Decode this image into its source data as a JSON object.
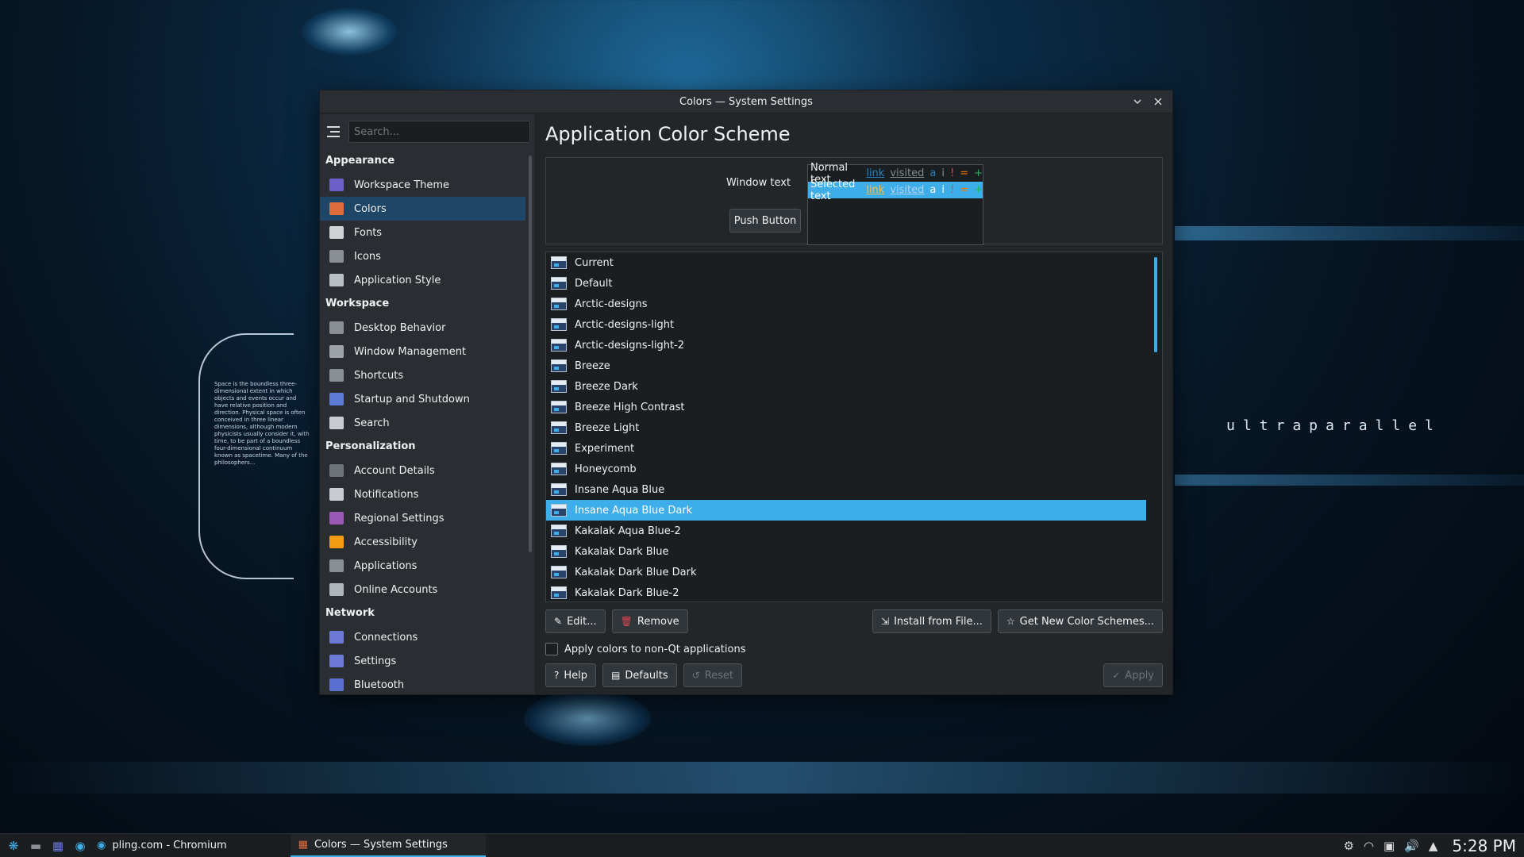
{
  "window": {
    "title": "Colors — System Settings"
  },
  "sidebar": {
    "search_placeholder": "Search...",
    "sections": [
      {
        "title": "Appearance",
        "items": [
          {
            "label": "Workspace Theme",
            "color": "#6c5fc7"
          },
          {
            "label": "Colors",
            "color": "#e06c3c",
            "active": true
          },
          {
            "label": "Fonts",
            "color": "#cfd3d6"
          },
          {
            "label": "Icons",
            "color": "#8a8f94"
          },
          {
            "label": "Application Style",
            "color": "#b9bec3"
          }
        ]
      },
      {
        "title": "Workspace",
        "items": [
          {
            "label": "Desktop Behavior",
            "color": "#8a8f94"
          },
          {
            "label": "Window Management",
            "color": "#9ea3a8"
          },
          {
            "label": "Shortcuts",
            "color": "#8a8f94"
          },
          {
            "label": "Startup and Shutdown",
            "color": "#5c7bd6"
          },
          {
            "label": "Search",
            "color": "#c9cdd1"
          }
        ]
      },
      {
        "title": "Personalization",
        "items": [
          {
            "label": "Account Details",
            "color": "#6e7378"
          },
          {
            "label": "Notifications",
            "color": "#c9cdd1"
          },
          {
            "label": "Regional Settings",
            "color": "#9b59b6"
          },
          {
            "label": "Accessibility",
            "color": "#f39c12"
          },
          {
            "label": "Applications",
            "color": "#8a8f94"
          },
          {
            "label": "Online Accounts",
            "color": "#b0b5ba"
          }
        ]
      },
      {
        "title": "Network",
        "items": [
          {
            "label": "Connections",
            "color": "#6c7ad6"
          },
          {
            "label": "Settings",
            "color": "#6c7ad6"
          },
          {
            "label": "Bluetooth",
            "color": "#5a6fd0"
          }
        ]
      }
    ]
  },
  "main": {
    "title": "Application Color Scheme",
    "preview": {
      "window_text_label": "Window text",
      "push_button_label": "Push Button",
      "normal": {
        "text": "Normal text",
        "link": "link",
        "visited": "visited",
        "a": "a",
        "i": "i",
        "neg": "!",
        "neu": "=",
        "pos": "+"
      },
      "selected": {
        "text": "Selected text",
        "link": "link",
        "visited": "visited",
        "a": "a",
        "i": "i",
        "neg": "!",
        "neu": "=",
        "pos": "+"
      }
    },
    "schemes": [
      "Current",
      "Default",
      "Arctic-designs",
      "Arctic-designs-light",
      "Arctic-designs-light-2",
      "Breeze",
      "Breeze Dark",
      "Breeze High Contrast",
      "Breeze Light",
      "Experiment",
      "Honeycomb",
      "Insane Aqua Blue",
      "Insane Aqua Blue Dark",
      "Kakalak Aqua Blue-2",
      "Kakalak Dark Blue",
      "Kakalak Dark Blue Dark",
      "Kakalak Dark Blue-2"
    ],
    "selected_scheme": "Insane Aqua Blue Dark",
    "buttons": {
      "edit": "Edit...",
      "remove": "Remove",
      "install": "Install from File...",
      "get_new": "Get New Color Schemes..."
    },
    "checkbox_label": "Apply colors to non-Qt applications",
    "footer": {
      "help": "Help",
      "defaults": "Defaults",
      "reset": "Reset",
      "apply": "Apply"
    }
  },
  "taskbar": {
    "tasks": [
      "pling.com - Chromium",
      "Colors — System Settings"
    ],
    "clock": "5:28 PM"
  },
  "wallpaper": {
    "brand": "ultraparallel",
    "text": "Space is the boundless three-dimensional extent in which objects and events occur and have relative position and direction. Physical space is often conceived in three linear dimensions, although modern physicists usually consider it, with time, to be part of a boundless four-dimensional continuum known as spacetime. Many of the philosophers..."
  },
  "colors": {
    "accent": "#3daee9",
    "window_bg": "#232629"
  }
}
